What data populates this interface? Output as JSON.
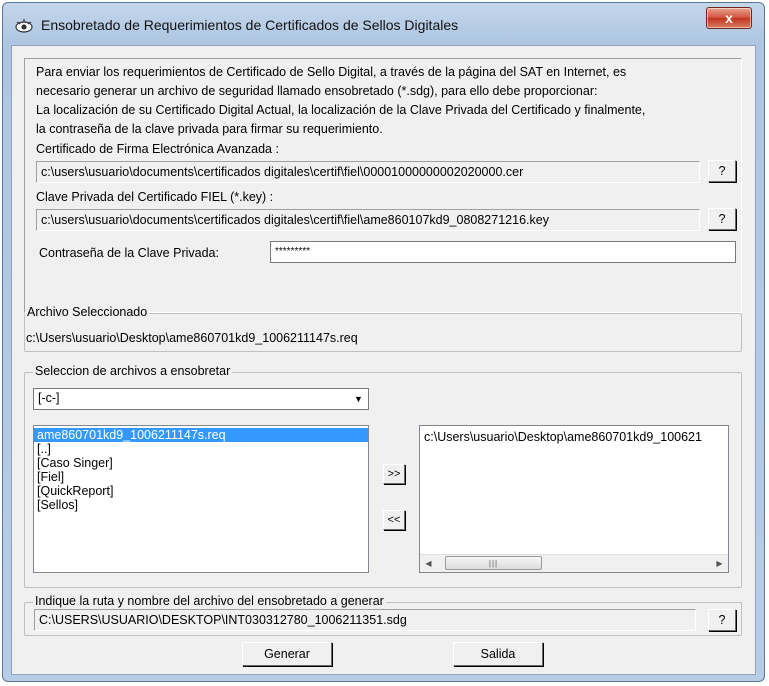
{
  "window": {
    "title": "Ensobretado de Requerimientos de Certificados de Sellos Digitales",
    "close_label": "x"
  },
  "intro": {
    "lines": [
      "Para enviar  los requerimientos  de Certificado de Sello  Digital, a través de la página del SAT en  Internet, es",
      "necesario generar un archivo de seguridad llamado ensobretado (*.sdg),  para ello debe proporcionar:",
      "La localización de su Certificado Digital Actual, la localización de la Clave Privada  del Certificado y finalmente,",
      "la contraseña de la clave privada para firmar su requerimiento."
    ]
  },
  "certificate": {
    "label": "Certificado de Firma Electrónica Avanzada :",
    "path": "c:\\users\\usuario\\documents\\certificados digitales\\certif\\fiel\\00001000000002020000.cer",
    "browse_label": "?"
  },
  "private_key": {
    "label": "Clave Privada del Certificado FIEL (*.key) :",
    "path": "c:\\users\\usuario\\documents\\certificados digitales\\certif\\fiel\\ame860107kd9_0808271216.key",
    "browse_label": "?"
  },
  "password": {
    "label": "Contraseña de la Clave Privada:",
    "value": "*********"
  },
  "selected_file": {
    "group_title": "Archivo Seleccionado",
    "path": "c:\\Users\\usuario\\Desktop\\ame860701kd9_1006211147s.req"
  },
  "file_selection": {
    "group_title": "Seleccion de archivos a ensobretar",
    "drive": "[-c-]",
    "files": [
      "ame860701kd9_1006211147s.req",
      "[..]",
      "[Caso Singer]",
      "[Fiel]",
      "[QuickReport]",
      "[Sellos]"
    ],
    "selected_index": 0,
    "add_label": ">>",
    "remove_label": "<<",
    "chosen": [
      "c:\\Users\\usuario\\Desktop\\ame860701kd9_100621"
    ]
  },
  "output": {
    "group_title": "Indique la ruta y nombre del archivo del ensobretado a generar",
    "path": "C:\\USERS\\USUARIO\\DESKTOP\\INT030312780_1006211351.sdg",
    "browse_label": "?"
  },
  "actions": {
    "generate_label": "Generar",
    "exit_label": "Salida"
  },
  "icons": {
    "app": "eye-icon",
    "close": "close-icon",
    "dropdown": "chevron-down-icon",
    "scroll_left": "arrow-left-icon",
    "scroll_right": "arrow-right-icon"
  },
  "colors": {
    "selection": "#3399ff",
    "close_button": "#c0361f",
    "window_frame": "#b7cde6"
  }
}
